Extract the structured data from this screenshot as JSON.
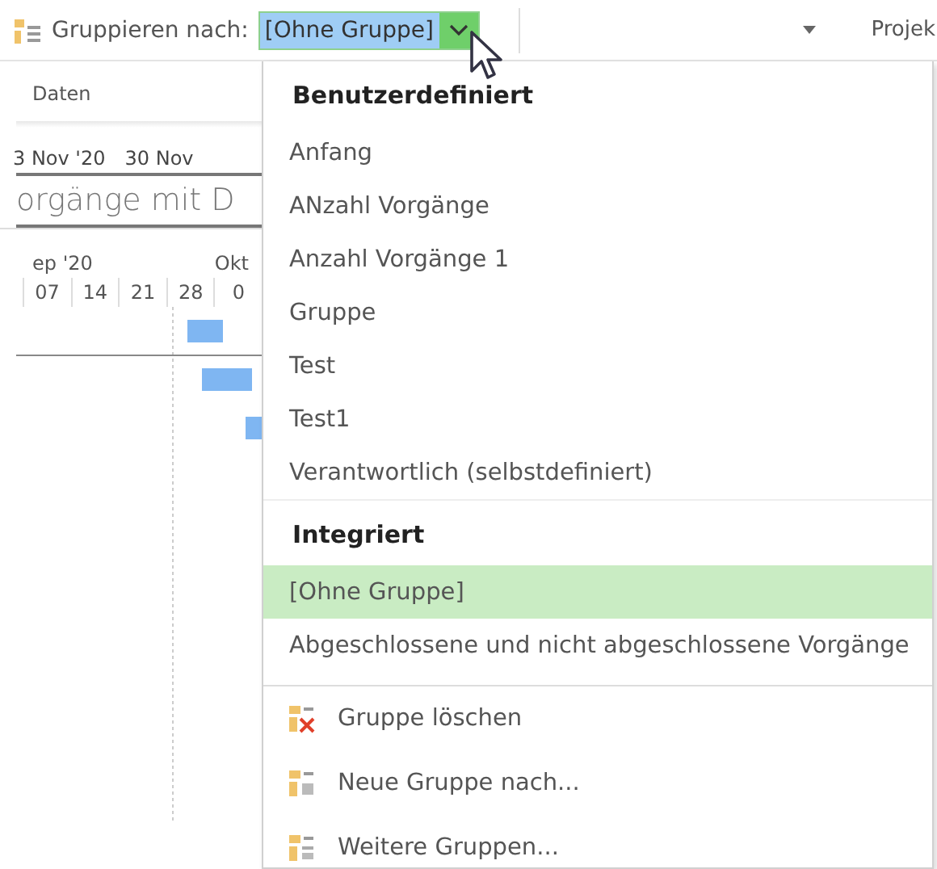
{
  "toolbar": {
    "label": "Gruppieren nach:",
    "combo_value": "[Ohne Gruppe]",
    "combo_selected": true,
    "right_label": "Projek"
  },
  "background": {
    "tab": "Daten",
    "ruler": [
      "3 Nov '20",
      "30 Nov"
    ],
    "title": "orgänge mit D",
    "timescale_top": [
      "ep '20",
      "Okt"
    ],
    "days": [
      "07",
      "14",
      "21",
      "28",
      "0"
    ]
  },
  "menu": {
    "sections": [
      {
        "header": "Benutzerdefiniert",
        "items": [
          {
            "label": "Anfang",
            "selected": false
          },
          {
            "label": "ANzahl Vorgänge",
            "selected": false
          },
          {
            "label": "Anzahl Vorgänge 1",
            "selected": false
          },
          {
            "label": "Gruppe",
            "selected": false
          },
          {
            "label": "Test",
            "selected": false
          },
          {
            "label": "Test1",
            "selected": false
          },
          {
            "label": "Verantwortlich (selbstdefiniert)",
            "selected": false
          }
        ]
      },
      {
        "header": "Integriert",
        "items": [
          {
            "label": "[Ohne Gruppe]",
            "selected": true
          },
          {
            "label": "Abgeschlossene und nicht abgeschlossene Vorgänge",
            "selected": false
          }
        ]
      }
    ],
    "commands": [
      {
        "label": "Gruppe löschen",
        "kind": "delete"
      },
      {
        "label": "Neue Gruppe nach...",
        "kind": "new"
      },
      {
        "label": "Weitere Gruppen...",
        "kind": "more"
      }
    ]
  }
}
